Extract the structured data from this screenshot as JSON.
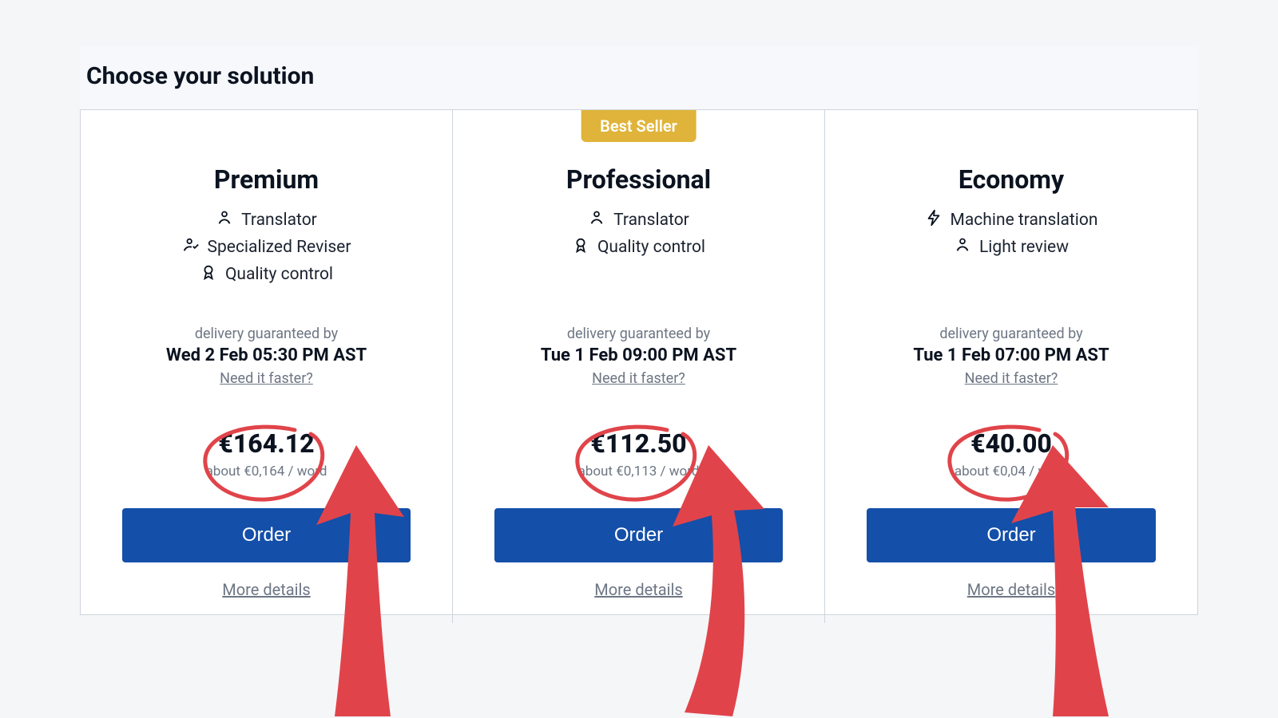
{
  "heading": "Choose your solution",
  "badge": "Best Seller",
  "common": {
    "delivery_label": "delivery guaranteed by",
    "faster_link": "Need it faster?",
    "order_label": "Order",
    "more_details": "More details"
  },
  "tiers": [
    {
      "title": "Premium",
      "features": [
        {
          "icon": "person",
          "label": "Translator"
        },
        {
          "icon": "person-check",
          "label": "Specialized Reviser"
        },
        {
          "icon": "ribbon",
          "label": "Quality control"
        }
      ],
      "delivery_time": "Wed 2 Feb 05:30 PM AST",
      "price": "€164.12",
      "per_word": "about €0,164 / word"
    },
    {
      "title": "Professional",
      "badge": true,
      "features": [
        {
          "icon": "person",
          "label": "Translator"
        },
        {
          "icon": "ribbon",
          "label": "Quality control"
        }
      ],
      "delivery_time": "Tue 1 Feb 09:00 PM AST",
      "price": "€112.50",
      "per_word": "about €0,113 / word"
    },
    {
      "title": "Economy",
      "features": [
        {
          "icon": "bolt",
          "label": "Machine translation"
        },
        {
          "icon": "person",
          "label": "Light review"
        }
      ],
      "delivery_time": "Tue 1 Feb 07:00 PM AST",
      "price": "€40.00",
      "per_word": "about €0,04 / word"
    }
  ],
  "colors": {
    "accent_blue": "#144fa9",
    "badge_gold": "#e0b43a",
    "annotation_red": "#e0444a"
  }
}
